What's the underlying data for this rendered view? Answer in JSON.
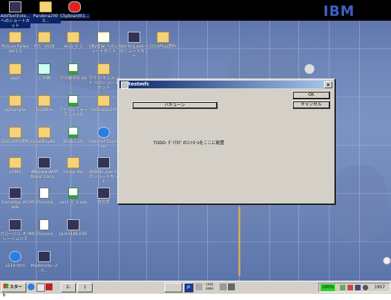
{
  "desktop": {
    "top_icons": [
      {
        "label": "AddTextExte... へのショートカット",
        "icon": "app-icon"
      },
      {
        "label": "Pandora2003...",
        "icon": "folder-icon"
      },
      {
        "label": "Clipboard01...",
        "icon": "red-flower-icon"
      }
    ],
    "icons": [
      {
        "label": "Picture Retex Ver1.0",
        "icon": "folder-icon"
      },
      {
        "label": "RTC_V028",
        "icon": "folder-icon"
      },
      {
        "label": "Ver1_0_1",
        "icon": "folder-icon"
      },
      {
        "label": "VBVIEW へのショートカット",
        "icon": "vb-icon"
      },
      {
        "label": "Sterling.exe へのショートカット",
        "icon": "app-icon"
      },
      {
        "label": "ClickPlus資料",
        "icon": "folder-icon"
      },
      {
        "label": "appli",
        "icon": "folder-icon"
      },
      {
        "label": "ごみ箱",
        "icon": "recycle-bin-icon"
      },
      {
        "label": "からめのD.xls",
        "icon": "excel-icon"
      },
      {
        "label": "マイ ドキュメント へのショートカット",
        "icon": "folder-icon"
      },
      {
        "label": "ppSample",
        "icon": "folder-icon"
      },
      {
        "label": "DustBox",
        "icon": "folder-icon"
      },
      {
        "label": "ファイルフォーマット.xls",
        "icon": "excel-icon"
      },
      {
        "label": "rocknesx20f",
        "icon": "folder-icon"
      },
      {
        "label": "DOCOMO資料",
        "icon": "folder-icon"
      },
      {
        "label": "VisualBoyAd...",
        "icon": "folder-icon"
      },
      {
        "label": "Book1.xls",
        "icon": "excel-icon"
      },
      {
        "label": "Internet Explorer",
        "icon": "ie-icon"
      },
      {
        "label": "LOMS",
        "icon": "folder-icon"
      },
      {
        "label": "dBpowerAMP Music Conv...",
        "icon": "app-icon"
      },
      {
        "label": "rouge.ike",
        "icon": "folder-icon"
      },
      {
        "label": "WWWC.exe へのショートカット",
        "icon": "app-icon"
      },
      {
        "label": "GameSpy Arcade",
        "icon": "app-icon"
      },
      {
        "label": "MCESource_...",
        "icon": "doc-icon"
      },
      {
        "label": "ver1_0_1.exe",
        "icon": "excel-icon"
      },
      {
        "label": "窓の手",
        "icon": "app-icon"
      },
      {
        "label": "グローバル オペレーションズ",
        "icon": "app-icon"
      },
      {
        "label": "MCESource_...",
        "icon": "doc-icon"
      },
      {
        "label": "ULH3189.EXE",
        "icon": "app-icon"
      },
      {
        "label": "s214.htm",
        "icon": "ie-icon"
      },
      {
        "label": "Madonote~20...",
        "icon": "app-icon"
      }
    ]
  },
  "dialog": {
    "title": "testmfc",
    "close_glyph": "×",
    "ok_label": "OK",
    "cancel_label": "キャンセル",
    "action_label": "バキューン",
    "todo_text": "TODO: ﾀﾞｲｱﾛｸﾞのｺﾝﾄﾛｰﾙをここに配置"
  },
  "taskbar": {
    "start_label": "スタート",
    "task_count_label": "2-",
    "task_icon_label": "1",
    "ime_label": "JP",
    "caps_label": "CAPS",
    "kana_label": "KANA",
    "battery_label": "100%",
    "clock": "1957"
  },
  "colors": {
    "titlebar": "#0a246a",
    "desktop": "#6d86b8",
    "taskbar": "#d4d0c8"
  }
}
